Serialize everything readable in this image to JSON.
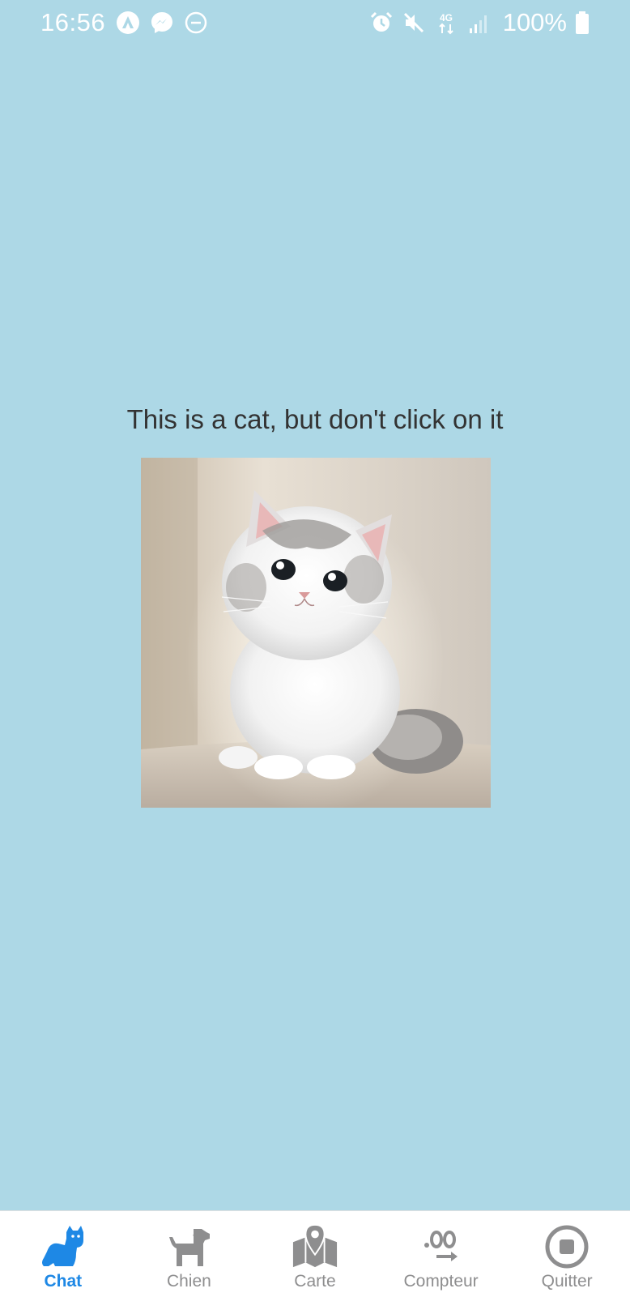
{
  "status_bar": {
    "time": "16:56",
    "left_icons": [
      "android-auto-icon",
      "messenger-icon",
      "dnd-icon"
    ],
    "right_icons": [
      "alarm-icon",
      "mute-icon",
      "4g-icon",
      "signal-icon"
    ],
    "battery": "100%",
    "network_label": "4G"
  },
  "main": {
    "caption": "This is a cat, but don't click on it",
    "image_alt": "fluffy grey and white kitten"
  },
  "tabs": [
    {
      "label": "Chat",
      "icon": "cat-icon",
      "active": true
    },
    {
      "label": "Chien",
      "icon": "dog-icon",
      "active": false
    },
    {
      "label": "Carte",
      "icon": "map-icon",
      "active": false
    },
    {
      "label": "Compteur",
      "icon": "counter-icon",
      "active": false
    },
    {
      "label": "Quitter",
      "icon": "stop-icon",
      "active": false
    }
  ],
  "colors": {
    "background": "#add8e6",
    "active_tab": "#1e88e5",
    "inactive_tab": "#8e8e8f",
    "caption_text": "#333333"
  }
}
